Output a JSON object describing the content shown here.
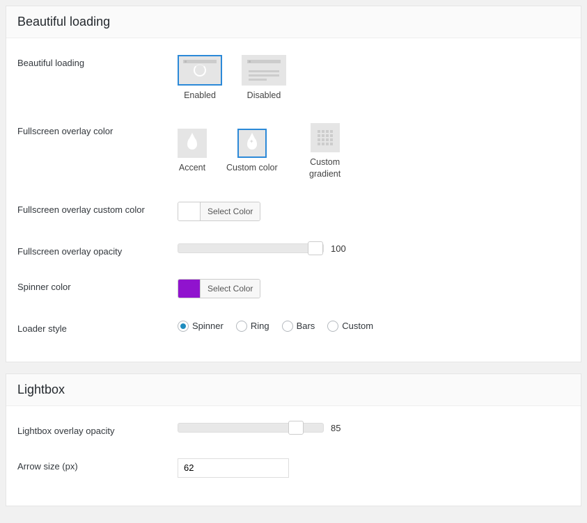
{
  "section1": {
    "title": "Beautiful loading",
    "beautiful_loading": {
      "label": "Beautiful loading",
      "enabled": "Enabled",
      "disabled": "Disabled"
    },
    "overlay_color": {
      "label": "Fullscreen overlay color",
      "accent": "Accent",
      "custom_color": "Custom color",
      "custom_gradient": "Custom gradient"
    },
    "overlay_custom_color": {
      "label": "Fullscreen overlay custom color",
      "button": "Select Color",
      "swatch": "#ffffff"
    },
    "overlay_opacity": {
      "label": "Fullscreen overlay opacity",
      "value": "100"
    },
    "spinner_color": {
      "label": "Spinner color",
      "button": "Select Color",
      "swatch": "#9013ce"
    },
    "loader_style": {
      "label": "Loader style",
      "options": {
        "spinner": "Spinner",
        "ring": "Ring",
        "bars": "Bars",
        "custom": "Custom"
      }
    }
  },
  "section2": {
    "title": "Lightbox",
    "lightbox_opacity": {
      "label": "Lightbox overlay opacity",
      "value": "85"
    },
    "arrow_size": {
      "label": "Arrow size (px)",
      "value": "62"
    }
  }
}
